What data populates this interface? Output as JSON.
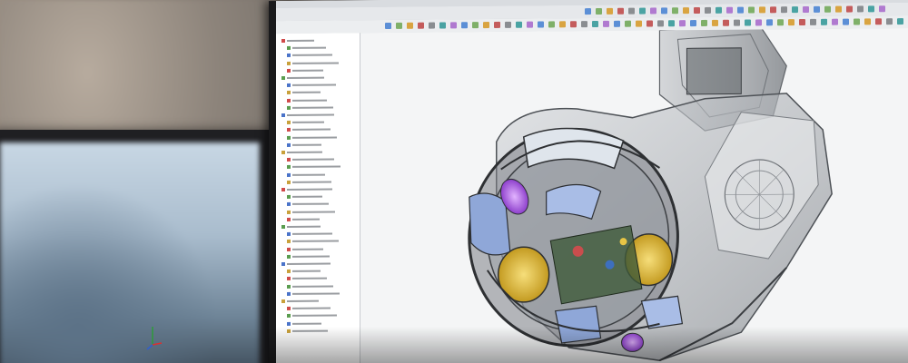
{
  "scene": {
    "description_free": true
  },
  "monitor": {
    "window_title": "",
    "tree_items": [
      "",
      "",
      "",
      "",
      "",
      "",
      "",
      "",
      "",
      "",
      "",
      "",
      "",
      "",
      "",
      "",
      "",
      "",
      "",
      "",
      "",
      "",
      "",
      "",
      "",
      "",
      "",
      "",
      "",
      "",
      "",
      "",
      "",
      "",
      "",
      "",
      "",
      "",
      "",
      ""
    ]
  },
  "colors": {
    "viewport_bg": "#f4f5f6",
    "model_purple": "#b169e0",
    "model_yellow": "#e8c545",
    "model_blue": "#8fa7d8",
    "model_body": "#8f9196",
    "model_dark": "#2e3033"
  },
  "icons": {
    "axis": "xyz-axis-triad-icon"
  }
}
